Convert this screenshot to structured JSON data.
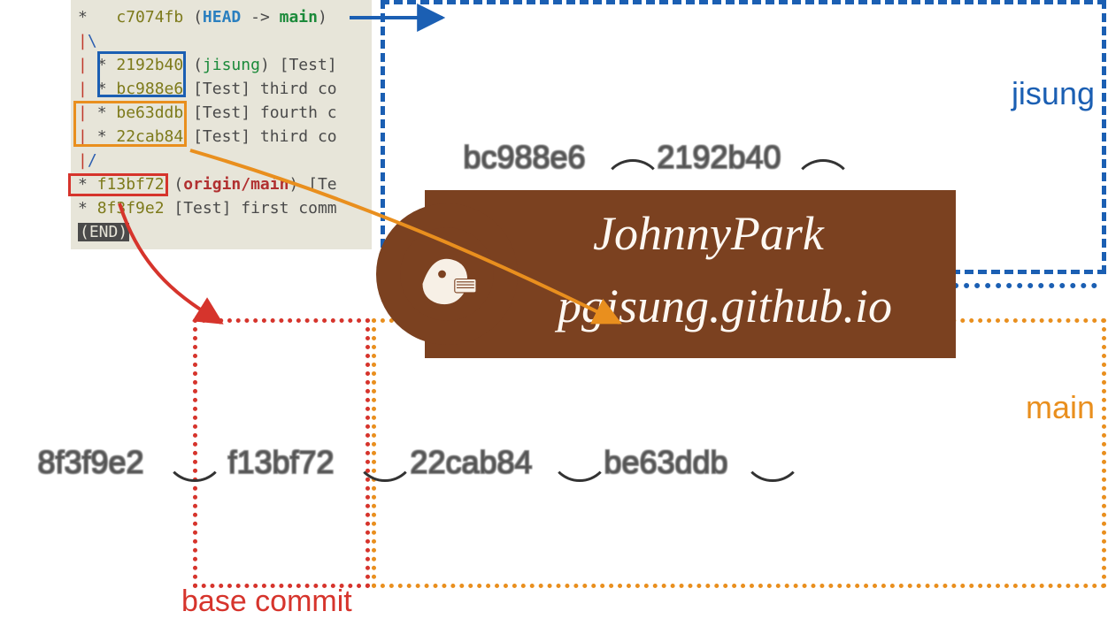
{
  "terminal": {
    "lines": [
      {
        "star": "*",
        "graph": "   ",
        "hash": "c7074fb",
        "refs_open": "(",
        "head": "HEAD",
        "head_arrow": " -> ",
        "branch": "main",
        "refs_close": ")",
        "msg": ""
      },
      {
        "graph_only": "|\\  "
      },
      {
        "star": "*",
        "graph": " | ",
        "hash": "2192b40",
        "refs_open": "(",
        "branch2": "jisung",
        "refs_close": ")",
        "msg": " [Test]"
      },
      {
        "star": "*",
        "graph": " | ",
        "hash": "bc988e6",
        "msg": " [Test] third co"
      },
      {
        "star": "*",
        "graph": " | ",
        "hash": "be63ddb",
        "msg": " [Test] fourth c"
      },
      {
        "star": "*",
        "graph": " | ",
        "hash": "22cab84",
        "msg": " [Test] third co"
      },
      {
        "graph_only": "|/  "
      },
      {
        "star": "*",
        "graph": " ",
        "hash": "f13bf72",
        "refs_open": "(",
        "origin": "origin/main",
        "refs_close": ")",
        "msg": " [Te"
      },
      {
        "star": "*",
        "graph": " ",
        "hash": "8f3f9e2",
        "msg": " [Test] first comm"
      },
      {
        "end": "(END)"
      }
    ]
  },
  "branches": {
    "jisung_label": "jisung",
    "main_label": "main",
    "base_label": "base commit"
  },
  "commit_nodes": {
    "jisung_row": [
      "bc988e6",
      "2192b40"
    ],
    "main_row": [
      "8f3f9e2",
      "f13bf72",
      "22cab84",
      "be63ddb"
    ]
  },
  "watermark": {
    "name": "JohnnyPark",
    "site": "pgisung.github.io"
  },
  "colors": {
    "blue": "#1b5fb3",
    "orange": "#e98f1e",
    "red": "#d6342c",
    "brown": "#7b4120"
  }
}
